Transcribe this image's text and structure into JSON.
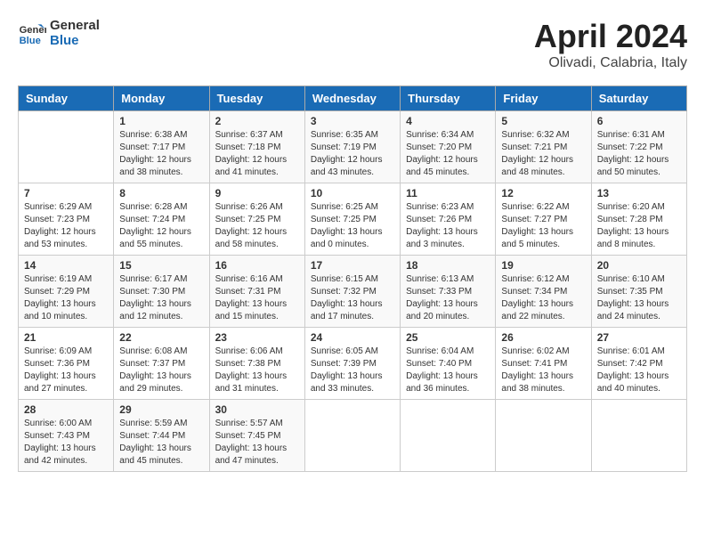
{
  "header": {
    "logo_line1": "General",
    "logo_line2": "Blue",
    "month_title": "April 2024",
    "location": "Olivadi, Calabria, Italy"
  },
  "columns": [
    "Sunday",
    "Monday",
    "Tuesday",
    "Wednesday",
    "Thursday",
    "Friday",
    "Saturday"
  ],
  "weeks": [
    [
      {
        "day": "",
        "sunrise": "",
        "sunset": "",
        "daylight": ""
      },
      {
        "day": "1",
        "sunrise": "Sunrise: 6:38 AM",
        "sunset": "Sunset: 7:17 PM",
        "daylight": "Daylight: 12 hours and 38 minutes."
      },
      {
        "day": "2",
        "sunrise": "Sunrise: 6:37 AM",
        "sunset": "Sunset: 7:18 PM",
        "daylight": "Daylight: 12 hours and 41 minutes."
      },
      {
        "day": "3",
        "sunrise": "Sunrise: 6:35 AM",
        "sunset": "Sunset: 7:19 PM",
        "daylight": "Daylight: 12 hours and 43 minutes."
      },
      {
        "day": "4",
        "sunrise": "Sunrise: 6:34 AM",
        "sunset": "Sunset: 7:20 PM",
        "daylight": "Daylight: 12 hours and 45 minutes."
      },
      {
        "day": "5",
        "sunrise": "Sunrise: 6:32 AM",
        "sunset": "Sunset: 7:21 PM",
        "daylight": "Daylight: 12 hours and 48 minutes."
      },
      {
        "day": "6",
        "sunrise": "Sunrise: 6:31 AM",
        "sunset": "Sunset: 7:22 PM",
        "daylight": "Daylight: 12 hours and 50 minutes."
      }
    ],
    [
      {
        "day": "7",
        "sunrise": "Sunrise: 6:29 AM",
        "sunset": "Sunset: 7:23 PM",
        "daylight": "Daylight: 12 hours and 53 minutes."
      },
      {
        "day": "8",
        "sunrise": "Sunrise: 6:28 AM",
        "sunset": "Sunset: 7:24 PM",
        "daylight": "Daylight: 12 hours and 55 minutes."
      },
      {
        "day": "9",
        "sunrise": "Sunrise: 6:26 AM",
        "sunset": "Sunset: 7:25 PM",
        "daylight": "Daylight: 12 hours and 58 minutes."
      },
      {
        "day": "10",
        "sunrise": "Sunrise: 6:25 AM",
        "sunset": "Sunset: 7:25 PM",
        "daylight": "Daylight: 13 hours and 0 minutes."
      },
      {
        "day": "11",
        "sunrise": "Sunrise: 6:23 AM",
        "sunset": "Sunset: 7:26 PM",
        "daylight": "Daylight: 13 hours and 3 minutes."
      },
      {
        "day": "12",
        "sunrise": "Sunrise: 6:22 AM",
        "sunset": "Sunset: 7:27 PM",
        "daylight": "Daylight: 13 hours and 5 minutes."
      },
      {
        "day": "13",
        "sunrise": "Sunrise: 6:20 AM",
        "sunset": "Sunset: 7:28 PM",
        "daylight": "Daylight: 13 hours and 8 minutes."
      }
    ],
    [
      {
        "day": "14",
        "sunrise": "Sunrise: 6:19 AM",
        "sunset": "Sunset: 7:29 PM",
        "daylight": "Daylight: 13 hours and 10 minutes."
      },
      {
        "day": "15",
        "sunrise": "Sunrise: 6:17 AM",
        "sunset": "Sunset: 7:30 PM",
        "daylight": "Daylight: 13 hours and 12 minutes."
      },
      {
        "day": "16",
        "sunrise": "Sunrise: 6:16 AM",
        "sunset": "Sunset: 7:31 PM",
        "daylight": "Daylight: 13 hours and 15 minutes."
      },
      {
        "day": "17",
        "sunrise": "Sunrise: 6:15 AM",
        "sunset": "Sunset: 7:32 PM",
        "daylight": "Daylight: 13 hours and 17 minutes."
      },
      {
        "day": "18",
        "sunrise": "Sunrise: 6:13 AM",
        "sunset": "Sunset: 7:33 PM",
        "daylight": "Daylight: 13 hours and 20 minutes."
      },
      {
        "day": "19",
        "sunrise": "Sunrise: 6:12 AM",
        "sunset": "Sunset: 7:34 PM",
        "daylight": "Daylight: 13 hours and 22 minutes."
      },
      {
        "day": "20",
        "sunrise": "Sunrise: 6:10 AM",
        "sunset": "Sunset: 7:35 PM",
        "daylight": "Daylight: 13 hours and 24 minutes."
      }
    ],
    [
      {
        "day": "21",
        "sunrise": "Sunrise: 6:09 AM",
        "sunset": "Sunset: 7:36 PM",
        "daylight": "Daylight: 13 hours and 27 minutes."
      },
      {
        "day": "22",
        "sunrise": "Sunrise: 6:08 AM",
        "sunset": "Sunset: 7:37 PM",
        "daylight": "Daylight: 13 hours and 29 minutes."
      },
      {
        "day": "23",
        "sunrise": "Sunrise: 6:06 AM",
        "sunset": "Sunset: 7:38 PM",
        "daylight": "Daylight: 13 hours and 31 minutes."
      },
      {
        "day": "24",
        "sunrise": "Sunrise: 6:05 AM",
        "sunset": "Sunset: 7:39 PM",
        "daylight": "Daylight: 13 hours and 33 minutes."
      },
      {
        "day": "25",
        "sunrise": "Sunrise: 6:04 AM",
        "sunset": "Sunset: 7:40 PM",
        "daylight": "Daylight: 13 hours and 36 minutes."
      },
      {
        "day": "26",
        "sunrise": "Sunrise: 6:02 AM",
        "sunset": "Sunset: 7:41 PM",
        "daylight": "Daylight: 13 hours and 38 minutes."
      },
      {
        "day": "27",
        "sunrise": "Sunrise: 6:01 AM",
        "sunset": "Sunset: 7:42 PM",
        "daylight": "Daylight: 13 hours and 40 minutes."
      }
    ],
    [
      {
        "day": "28",
        "sunrise": "Sunrise: 6:00 AM",
        "sunset": "Sunset: 7:43 PM",
        "daylight": "Daylight: 13 hours and 42 minutes."
      },
      {
        "day": "29",
        "sunrise": "Sunrise: 5:59 AM",
        "sunset": "Sunset: 7:44 PM",
        "daylight": "Daylight: 13 hours and 45 minutes."
      },
      {
        "day": "30",
        "sunrise": "Sunrise: 5:57 AM",
        "sunset": "Sunset: 7:45 PM",
        "daylight": "Daylight: 13 hours and 47 minutes."
      },
      {
        "day": "",
        "sunrise": "",
        "sunset": "",
        "daylight": ""
      },
      {
        "day": "",
        "sunrise": "",
        "sunset": "",
        "daylight": ""
      },
      {
        "day": "",
        "sunrise": "",
        "sunset": "",
        "daylight": ""
      },
      {
        "day": "",
        "sunrise": "",
        "sunset": "",
        "daylight": ""
      }
    ]
  ]
}
